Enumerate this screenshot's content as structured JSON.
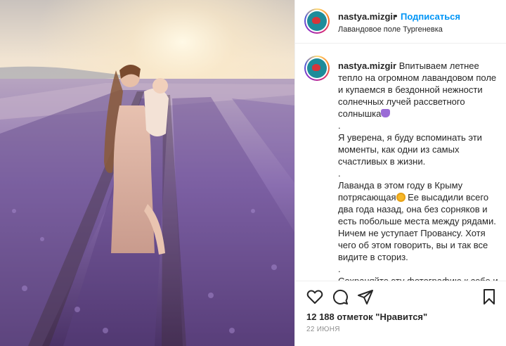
{
  "post": {
    "username": "nastya.mizgir",
    "separator": "•",
    "follow_label": "Подписаться",
    "location": "Лавандовое поле Тургеневка",
    "image_alt": "Мама с ребёнком на руках в лавандовом поле на рассвете"
  },
  "caption": {
    "author": "nastya.mizgir",
    "part1": " Впитываем летнее тепло на огромном лавандовом поле и купаемся в бездонной нежности солнечных лучей рассветного солнышка",
    "emoji1": "purple-heart",
    "part2": "\n.\nЯ уверена, я буду вспоминать эти моменты, как одни из самых счастливых в жизни.\n.\nЛаванда в этом году в Крыму потрясающая",
    "emoji2": "star-struck",
    "part3": " Ее высадили всего два года назад, она без сорняков и есть побольше места между рядами. Ничем не уступает Провансу. Хотя чего об этом говорить, вы и так все видите в сториз.\n.\nСохраняйте эту фотографию к себе и вы обязательно побываете на"
  },
  "actions": {
    "like_icon": "heart-icon",
    "comment_icon": "comment-icon",
    "share_icon": "share-icon",
    "save_icon": "bookmark-icon"
  },
  "likes": {
    "text": "12 188 отметок \"Нравится\""
  },
  "date": {
    "text": "22 ИЮНЯ"
  },
  "colors": {
    "accent": "#0095f6",
    "text": "#262626",
    "muted": "#8e8e8e",
    "border": "#efefef"
  }
}
